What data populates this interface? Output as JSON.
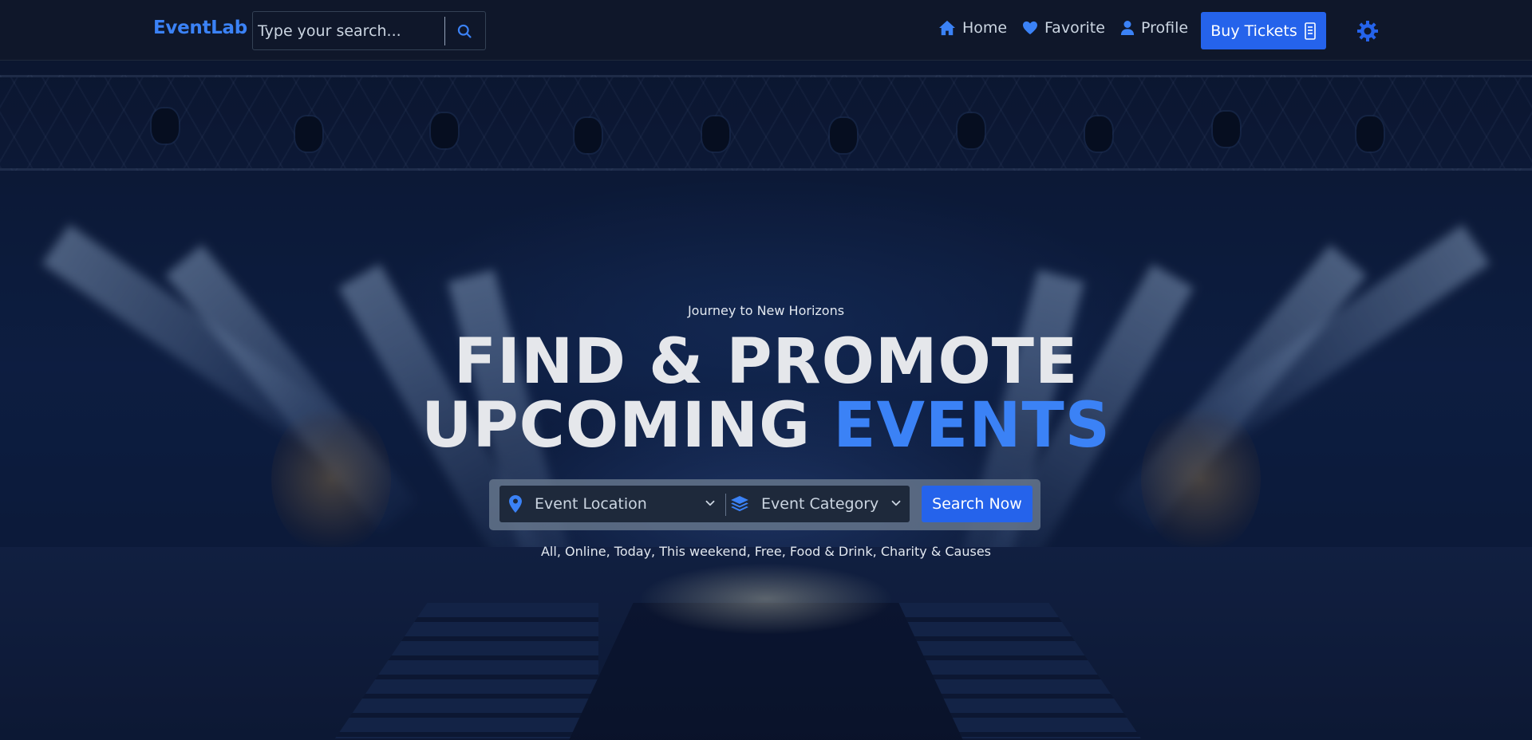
{
  "brand": {
    "name": "EventLab"
  },
  "search": {
    "placeholder": "Type your search..."
  },
  "nav": {
    "home": "Home",
    "favorite": "Favorite",
    "profile": "Profile",
    "buy_tickets": "Buy Tickets"
  },
  "hero": {
    "tagline": "Journey to New Horizons",
    "headline_line1": "FIND & PROMOTE",
    "headline_line2_a": "UPCOMING",
    "headline_line2_b": "EVENTS",
    "location_select": "Event Location",
    "category_select": "Event Category",
    "search_button": "Search Now",
    "quick_links": "All, Online, Today, This weekend, Free, Food & Drink, Charity & Causes"
  },
  "colors": {
    "accent": "#3b82f6",
    "primary_button": "#2563eb",
    "navbar_bg": "#0f172a"
  },
  "icons": {
    "search": "search-icon",
    "home": "home-icon",
    "favorite": "heart-icon",
    "profile": "user-icon",
    "tickets": "ticket-icon",
    "theme": "gear-icon",
    "location": "map-pin-icon",
    "category": "layers-icon",
    "dropdown": "chevron-down-icon"
  }
}
